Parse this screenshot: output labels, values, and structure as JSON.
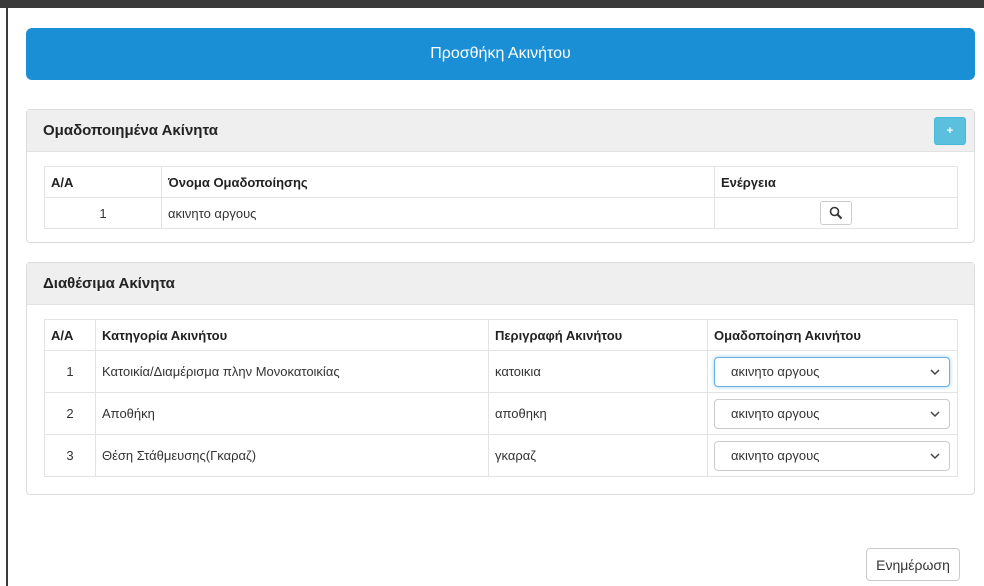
{
  "modal": {
    "title": "Προσθήκη Ακινήτου"
  },
  "grouped_panel": {
    "title": "Ομαδοποιημένα Ακίνητα",
    "add_label": "+",
    "columns": [
      "Α/Α",
      "Όνομα Ομαδοποίησης",
      "Ενέργεια"
    ],
    "rows": [
      {
        "aa": "1",
        "name": "ακινητο αργους",
        "action_icon": "search-icon"
      }
    ]
  },
  "available_panel": {
    "title": "Διαθέσιμα Ακίνητα",
    "columns": [
      "Α/Α",
      "Κατηγορία Ακινήτου",
      "Περιγραφή Ακινήτου",
      "Ομαδοποίηση Ακινήτου"
    ],
    "rows": [
      {
        "aa": "1",
        "category": "Κατοικία/Διαμέρισμα πλην Μονοκατοικίας",
        "description": "κατοικια",
        "grouping": "ακινητο αργους"
      },
      {
        "aa": "2",
        "category": "Αποθήκη",
        "description": "αποθηκη",
        "grouping": "ακινητο αργους"
      },
      {
        "aa": "3",
        "category": "Θέση Στάθμευσης(Γκαραζ)",
        "description": "γκαραζ",
        "grouping": "ακινητο αργους"
      }
    ]
  },
  "footer": {
    "update_label": "Ενημέρωση"
  },
  "colors": {
    "header_blue": "#1a8fd6",
    "add_button": "#5bc0de",
    "panel_head": "#efefef"
  }
}
